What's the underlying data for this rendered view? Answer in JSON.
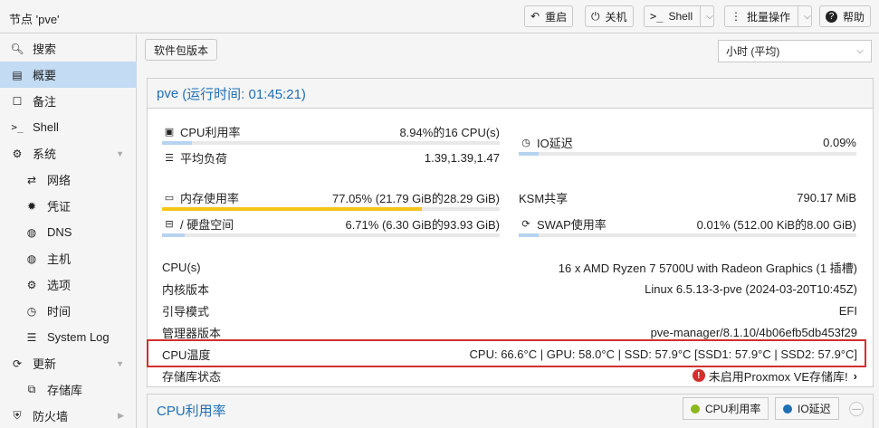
{
  "header": {
    "title": "节点 'pve'",
    "buttons": {
      "restart": "重启",
      "shutdown": "关机",
      "shell": "Shell",
      "bulk": "批量操作",
      "help": "帮助"
    }
  },
  "sidebar": {
    "items": [
      {
        "label": "搜索",
        "icon": "search-icon"
      },
      {
        "label": "概要",
        "icon": "summary-icon",
        "active": true
      },
      {
        "label": "备注",
        "icon": "notes-icon"
      },
      {
        "label": "Shell",
        "icon": "terminal-icon"
      },
      {
        "label": "系统",
        "icon": "cogs-icon",
        "expandable": true
      },
      {
        "label": "网络",
        "icon": "network-icon",
        "sub": true
      },
      {
        "label": "凭证",
        "icon": "certificate-icon",
        "sub": true
      },
      {
        "label": "DNS",
        "icon": "globe-icon",
        "sub": true
      },
      {
        "label": "主机",
        "icon": "globe-icon",
        "sub": true
      },
      {
        "label": "选项",
        "icon": "gear-icon",
        "sub": true
      },
      {
        "label": "时间",
        "icon": "clock-icon",
        "sub": true
      },
      {
        "label": "System Log",
        "icon": "list-icon",
        "sub": true
      },
      {
        "label": "更新",
        "icon": "refresh-icon",
        "expandable": true
      },
      {
        "label": "存储库",
        "icon": "files-icon",
        "sub": true
      },
      {
        "label": "防火墙",
        "icon": "shield-icon",
        "expandable": true
      }
    ]
  },
  "toolbar": {
    "package_versions": "软件包版本",
    "timeframe": "小时 (平均)"
  },
  "status": {
    "node": "pve",
    "uptime": "(运行时间: 01:45:21)",
    "cpu_label": "CPU利用率",
    "cpu_value": "8.94%的16 CPU(s)",
    "cpu_percent": 8.94,
    "io_label": "IO延迟",
    "io_value": "0.09%",
    "io_percent": 0.09,
    "load_label": "平均负荷",
    "load_value": "1.39,1.39,1.47",
    "mem_label": "内存使用率",
    "mem_value": "77.05% (21.79 GiB的28.29 GiB)",
    "mem_percent": 77.05,
    "ksm_label": "KSM共享",
    "ksm_value": "790.17 MiB",
    "disk_label": "/ 硬盘空间",
    "disk_value": "6.71% (6.30 GiB的93.93 GiB)",
    "disk_percent": 6.71,
    "swap_label": "SWAP使用率",
    "swap_value": "0.01% (512.00 KiB的8.00 GiB)",
    "swap_percent": 0.01,
    "info": [
      {
        "label": "CPU(s)",
        "value": "16 x AMD Ryzen 7 5700U with Radeon Graphics (1 插槽)"
      },
      {
        "label": "内核版本",
        "value": "Linux 6.5.13-3-pve (2024-03-20T10:45Z)"
      },
      {
        "label": "引导模式",
        "value": "EFI"
      },
      {
        "label": "管理器版本",
        "value": "pve-manager/8.1.10/4b06efb5db453f29"
      },
      {
        "label": "CPU温度",
        "value": "CPU: 66.6°C | GPU: 58.0°C | SSD: 57.9°C [SSD1: 57.9°C | SSD2: 57.9°C]"
      },
      {
        "label": "存储库状态",
        "value": "未启用Proxmox VE存储库!"
      }
    ]
  },
  "chart_panel": {
    "title": "CPU利用率",
    "legend": [
      "CPU利用率",
      "IO延迟"
    ]
  },
  "colors": {
    "accent": "#1f6fb5",
    "active_nav": "#c3dbf3",
    "bar_blue": "#b6d3f0",
    "bar_yellow": "#f5c518",
    "warn_red": "#d32f2f",
    "legend_green": "#8bb81c",
    "legend_blue": "#1f6fb5"
  }
}
